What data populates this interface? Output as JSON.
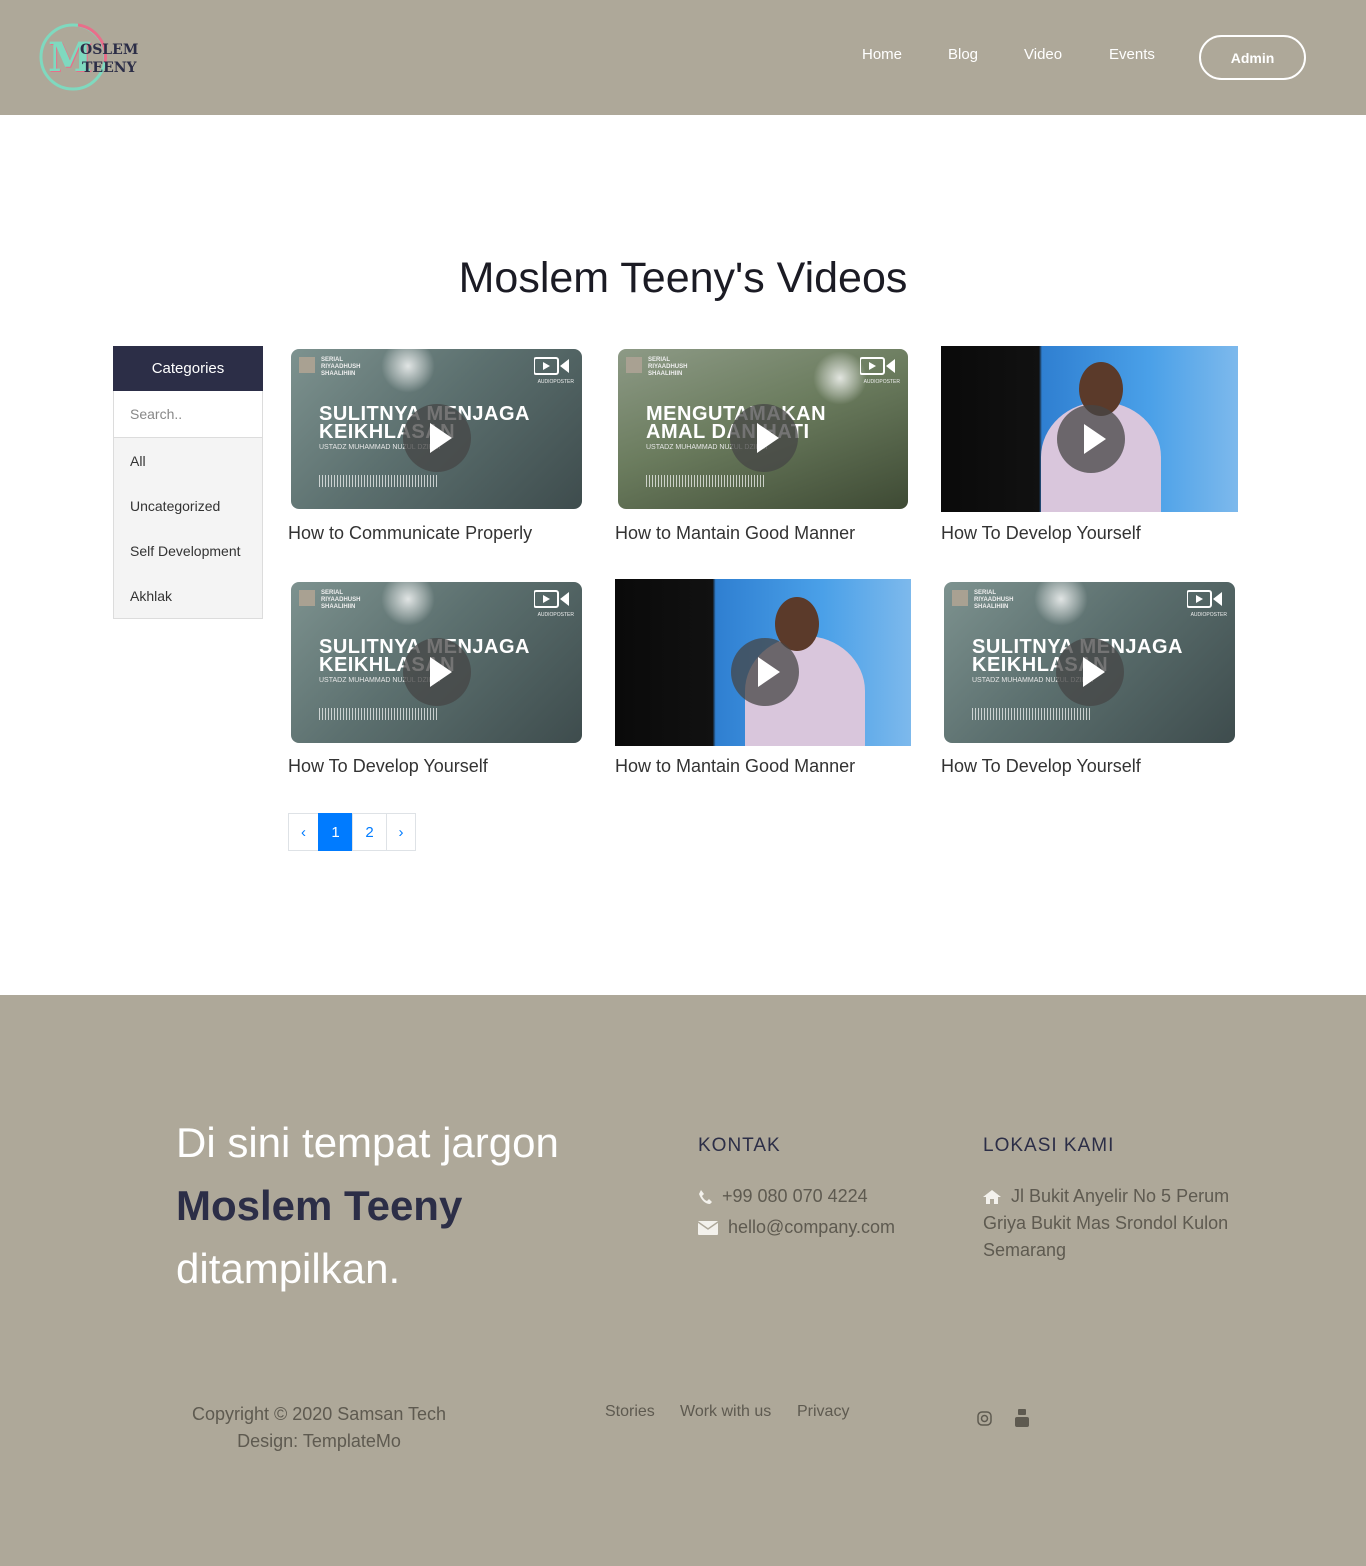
{
  "header": {
    "logo_text_top": "OSLEM",
    "logo_text_bottom": "TEENY",
    "logo_initial": "M",
    "nav": [
      "Home",
      "Blog",
      "Video",
      "Events"
    ],
    "admin_label": "Admin"
  },
  "page": {
    "title": "Moslem Teeny's Videos"
  },
  "sidebar": {
    "header": "Categories",
    "search_placeholder": "Search..",
    "categories": [
      "All",
      "Uncategorized",
      "Self Development",
      "Akhlak"
    ]
  },
  "posters": {
    "series": "SERIAL RIYAADHUSH SHAALIHIIN",
    "sulitnya_line1": "SULITNYA MENJAGA",
    "sulitnya_line2": "KEIKHLASAN",
    "mengutamakan_line1": "MENGUTAMAKAN",
    "mengutamakan_line2": "AMAL DAN HATI",
    "speaker": "USTADZ MUHAMMAD NUZUL DZIKRI",
    "badge": "AUDIOPOSTER"
  },
  "videos": [
    {
      "title": "How to Communicate Properly"
    },
    {
      "title": "How to Mantain Good Manner"
    },
    {
      "title": "How To Develop Yourself"
    },
    {
      "title": "How To Develop Yourself"
    },
    {
      "title": "How to Mantain Good Manner"
    },
    {
      "title": "How To Develop Yourself"
    }
  ],
  "pagination": {
    "prev": "‹",
    "pages": [
      "1",
      "2"
    ],
    "next": "›",
    "active": "1"
  },
  "footer": {
    "tagline_line1": "Di sini tempat jargon",
    "tagline_brand": "Moslem Teeny",
    "tagline_line3": "ditampilkan.",
    "contact_heading": "KONTAK",
    "phone": "+99 080 070 4224",
    "email": "hello@company.com",
    "location_heading": "LOKASI KAMI",
    "address_line1": "Jl Bukit Anyelir No 5 Perum",
    "address_line2": "Griya Bukit Mas Srondol Kulon",
    "address_line3": "Semarang",
    "copyright_line1": "Copyright © 2020 Samsan Tech",
    "copyright_line2": "Design: TemplateMo",
    "links": [
      "Stories",
      "Work with us",
      "Privacy"
    ],
    "social": [
      "instagram-icon",
      "youtube-icon"
    ]
  },
  "colors": {
    "header_bg": "#aea899",
    "sidebar_header_bg": "#2c2e47",
    "accent_blue": "#007bff",
    "logo_teal": "#7fd9bf",
    "logo_pink": "#e86f8a"
  }
}
